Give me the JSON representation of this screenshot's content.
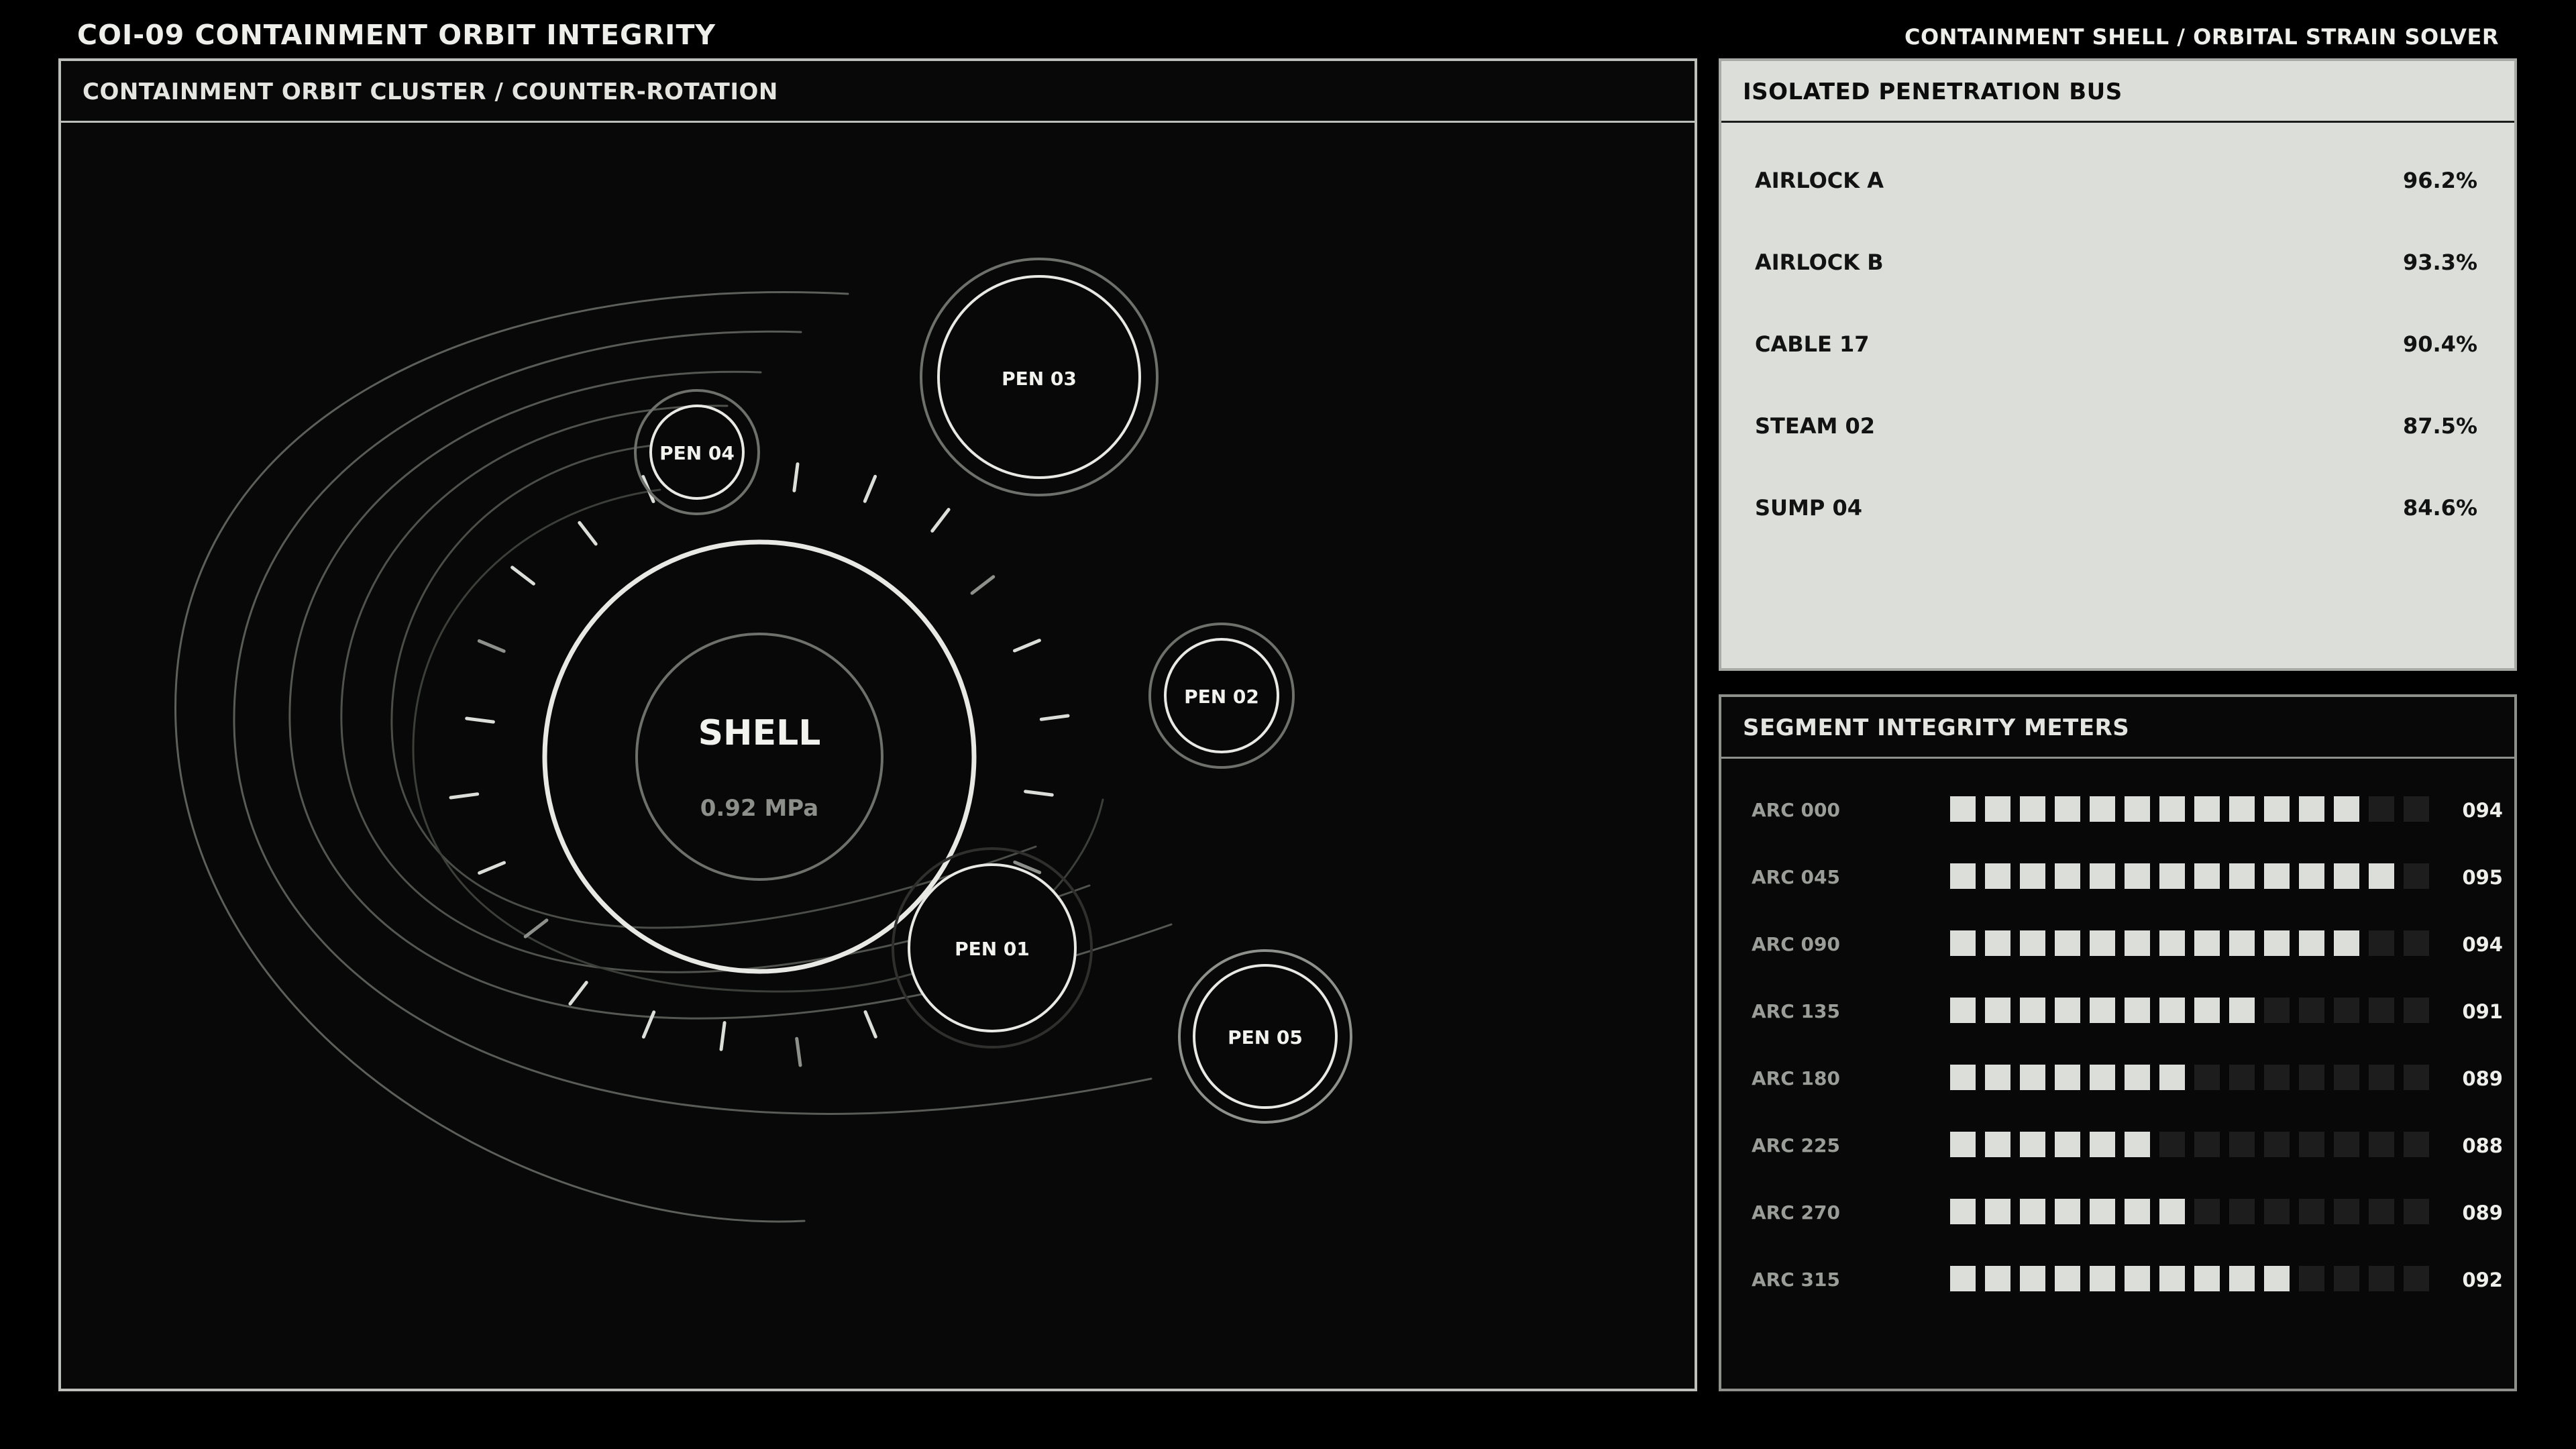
{
  "header": {
    "title": "COI-09  CONTAINMENT ORBIT INTEGRITY",
    "subtitle": "CONTAINMENT SHELL / ORBITAL STRAIN SOLVER"
  },
  "orbit_panel": {
    "title": "CONTAINMENT ORBIT CLUSTER / COUNTER-ROTATION",
    "shell": {
      "label": "SHELL",
      "pressure": "0.92 MPa"
    },
    "nodes": [
      {
        "id": "pen03",
        "label": "PEN 03"
      },
      {
        "id": "pen04",
        "label": "PEN 04"
      },
      {
        "id": "pen02",
        "label": "PEN 02"
      },
      {
        "id": "pen01",
        "label": "PEN 01"
      },
      {
        "id": "pen05",
        "label": "PEN 05"
      }
    ]
  },
  "bus_panel": {
    "title": "ISOLATED PENETRATION BUS",
    "rows": [
      {
        "label": "AIRLOCK A",
        "value": "96.2%"
      },
      {
        "label": "AIRLOCK B",
        "value": "93.3%"
      },
      {
        "label": "CABLE 17",
        "value": "90.4%"
      },
      {
        "label": "STEAM 02",
        "value": "87.5%"
      },
      {
        "label": "SUMP 04",
        "value": "84.6%"
      }
    ]
  },
  "segment_panel": {
    "title": "SEGMENT INTEGRITY METERS",
    "total_cells": 14,
    "cell_on_color": "#dcdeda",
    "cell_off_color": "#1c1d1c",
    "rows": [
      {
        "label": "ARC 000",
        "filled": 12,
        "value": "094"
      },
      {
        "label": "ARC 045",
        "filled": 13,
        "value": "095"
      },
      {
        "label": "ARC 090",
        "filled": 12,
        "value": "094"
      },
      {
        "label": "ARC 135",
        "filled": 9,
        "value": "091"
      },
      {
        "label": "ARC 180",
        "filled": 7,
        "value": "089"
      },
      {
        "label": "ARC 225",
        "filled": 6,
        "value": "088"
      },
      {
        "label": "ARC 270",
        "filled": 7,
        "value": "089"
      },
      {
        "label": "ARC 315",
        "filled": 10,
        "value": "092"
      }
    ]
  }
}
